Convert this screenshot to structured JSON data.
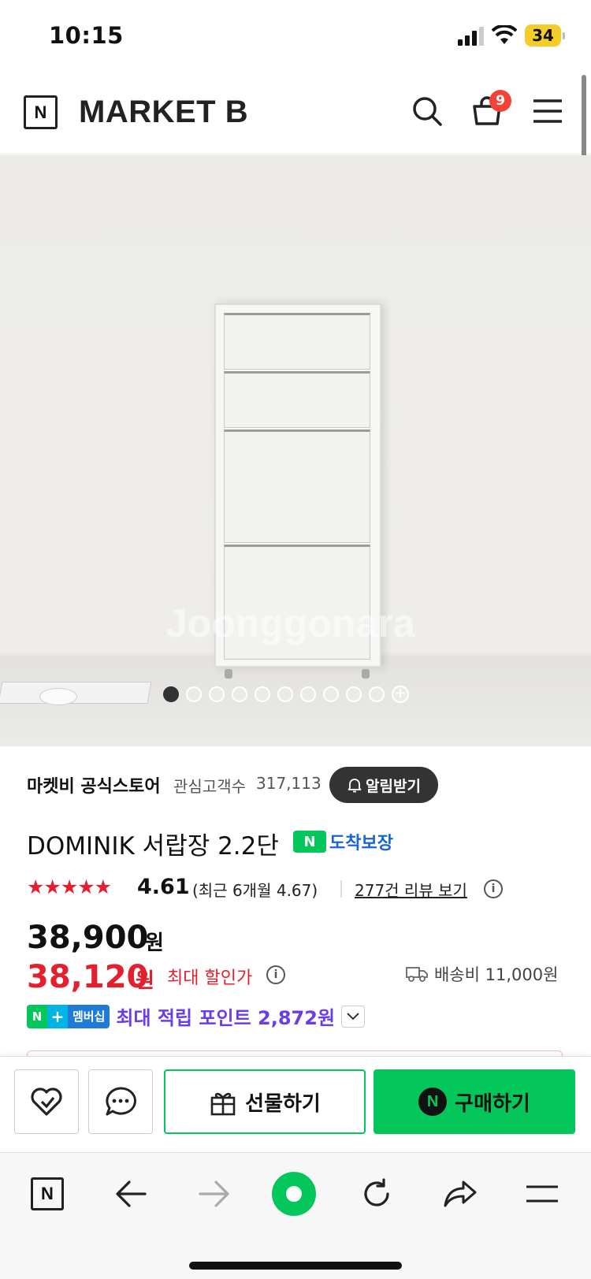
{
  "status_bar": {
    "time": "10:15",
    "battery": "34"
  },
  "header": {
    "logo": "N",
    "brand": "MARKET B",
    "cart_count": "9"
  },
  "hero": {
    "watermark": "Joonggonara",
    "slide_count": 10,
    "active_slide": 1
  },
  "store": {
    "name": "마켓비 공식스토어",
    "fans_label": "관심고객수",
    "fans_count": "317,113",
    "alarm_label": "알림받기"
  },
  "product": {
    "title": "DOMINIK 서랍장 2.2단",
    "delivery_badge": "도착보장",
    "stars": "★★★★★",
    "rating": "4.61",
    "recent_rating": "(최근 6개월 4.67)",
    "reviews_link": "277건 리뷰 보기",
    "original_price": "38,900",
    "original_unit": "원",
    "sale_price": "38,120",
    "sale_unit": "원",
    "max_discount": "최대 할인가",
    "shipping": "배송비 11,000원",
    "npay_n": "N",
    "npay_plus": "+",
    "npay_membership": "멤버십",
    "points": "최대 적립 포인트 2,872원"
  },
  "actions": {
    "gift_label": "선물하기",
    "buy_label": "구매하기",
    "buy_n": "N"
  },
  "browser": {
    "logo": "N"
  },
  "colors": {
    "naver_green": "#03c75a",
    "sale_red": "#e4202e",
    "points_purple": "#6a3de8",
    "delivery_blue": "#1a63d8"
  }
}
